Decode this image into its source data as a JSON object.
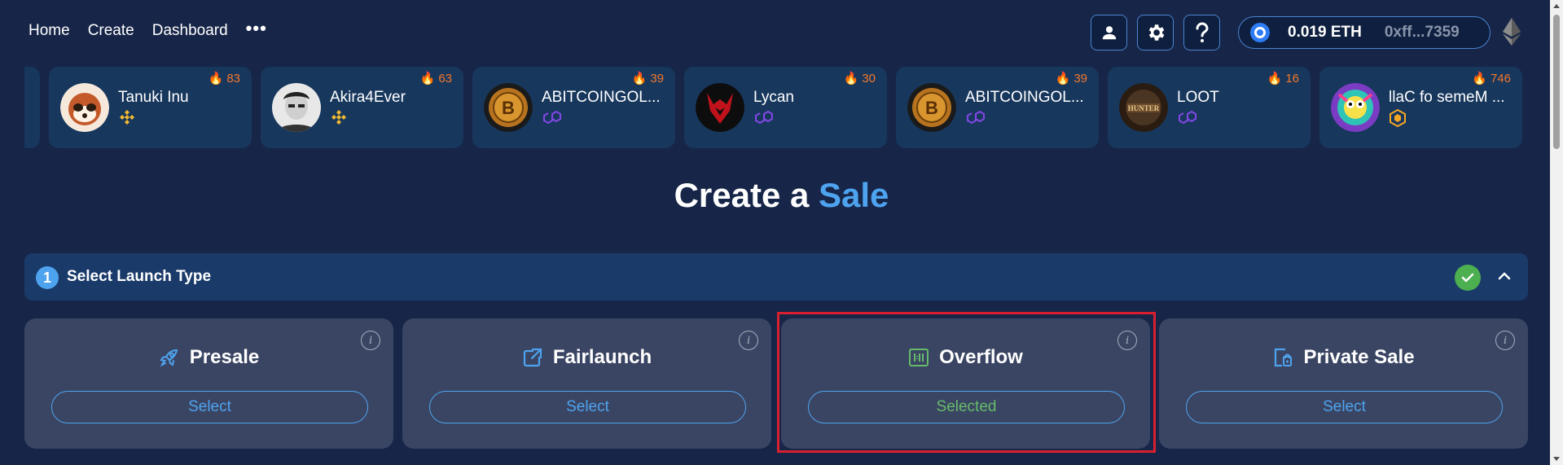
{
  "nav": {
    "home": "Home",
    "create": "Create",
    "dashboard": "Dashboard",
    "more": "•••"
  },
  "header": {
    "profile_icon": "user-icon",
    "settings_icon": "gear-icon",
    "help_icon": "question-icon",
    "wallet_balance": "0.019 ETH",
    "wallet_address": "0xff...7359",
    "network_icon": "ethereum-icon"
  },
  "trending": [
    {
      "name": "Tanuki Inu",
      "heat": "83",
      "chain": "bnb"
    },
    {
      "name": "Akira4Ever",
      "heat": "63",
      "chain": "bnb"
    },
    {
      "name": "ABITCOINGOL...",
      "heat": "39",
      "chain": "polygon"
    },
    {
      "name": "Lycan",
      "heat": "30",
      "chain": "polygon"
    },
    {
      "name": "ABITCOINGOL...",
      "heat": "39",
      "chain": "polygon"
    },
    {
      "name": "LOOT",
      "heat": "16",
      "chain": "polygon"
    },
    {
      "name": "llaC fo semeM ...",
      "heat": "746",
      "chain": "base"
    }
  ],
  "title": {
    "prefix": "Create a",
    "accent": "Sale"
  },
  "section": {
    "step": "1",
    "label": "Select Launch Type"
  },
  "options": [
    {
      "label": "Presale",
      "button": "Select",
      "icon": "rocket-icon"
    },
    {
      "label": "Fairlaunch",
      "button": "Select",
      "icon": "external-link-icon"
    },
    {
      "label": "Overflow",
      "button": "Selected",
      "icon": "overflow-icon"
    },
    {
      "label": "Private Sale",
      "button": "Select",
      "icon": "private-sale-icon"
    }
  ],
  "info_glyph": "i",
  "colors": {
    "background": "#172648",
    "accent": "#4ea3ef",
    "selected": "#66bb6a",
    "heat": "#f5772b",
    "highlight": "#d81f2f"
  }
}
